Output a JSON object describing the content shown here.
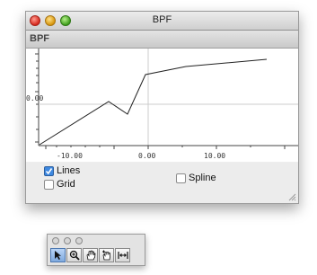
{
  "window": {
    "title": "BPF",
    "header_label": "BPF"
  },
  "plot": {
    "y_tick_label": "0.00",
    "x_tick_labels": [
      "-10.00",
      "0.00",
      "10.00"
    ],
    "line_color": "#222222",
    "grid_color": "#cccccc",
    "bpf_points": [
      [
        -20,
        -1.8
      ],
      [
        -5,
        -0.6
      ],
      [
        -3,
        -0.8
      ],
      [
        0,
        -0.08
      ],
      [
        5,
        0.0
      ],
      [
        15,
        0.1
      ]
    ]
  },
  "controls": {
    "lines_label": "Lines",
    "lines_checked": true,
    "grid_label": "Grid",
    "grid_checked": false,
    "spline_label": "Spline",
    "spline_checked": false
  },
  "palette": {
    "tools": [
      "arrow-icon",
      "zoom-icon",
      "hand-icon",
      "add-point-icon",
      "fit-icon"
    ],
    "selected_tool": "arrow-icon"
  }
}
